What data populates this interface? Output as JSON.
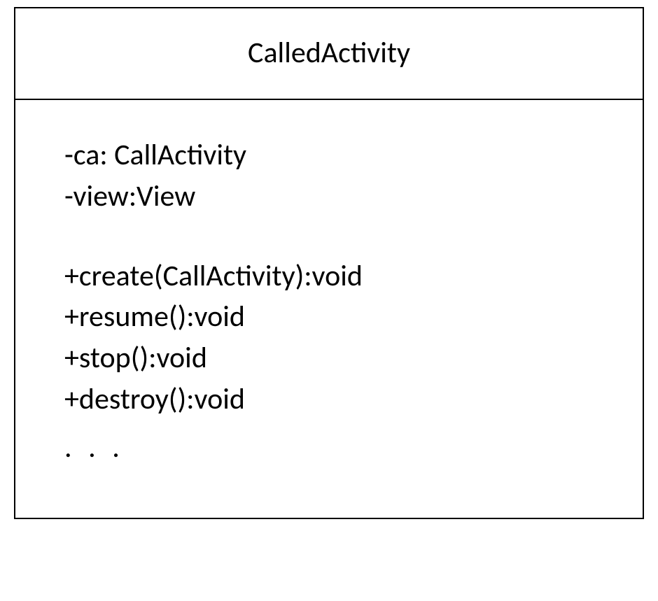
{
  "uml_class": {
    "name": "CalledActivity",
    "attributes": [
      "-ca: CallActivity",
      "-view:View"
    ],
    "methods": [
      "+create(CallActivity):void",
      "+resume():void",
      "+stop():void",
      "+destroy():void"
    ],
    "ellipsis": ". . ."
  }
}
